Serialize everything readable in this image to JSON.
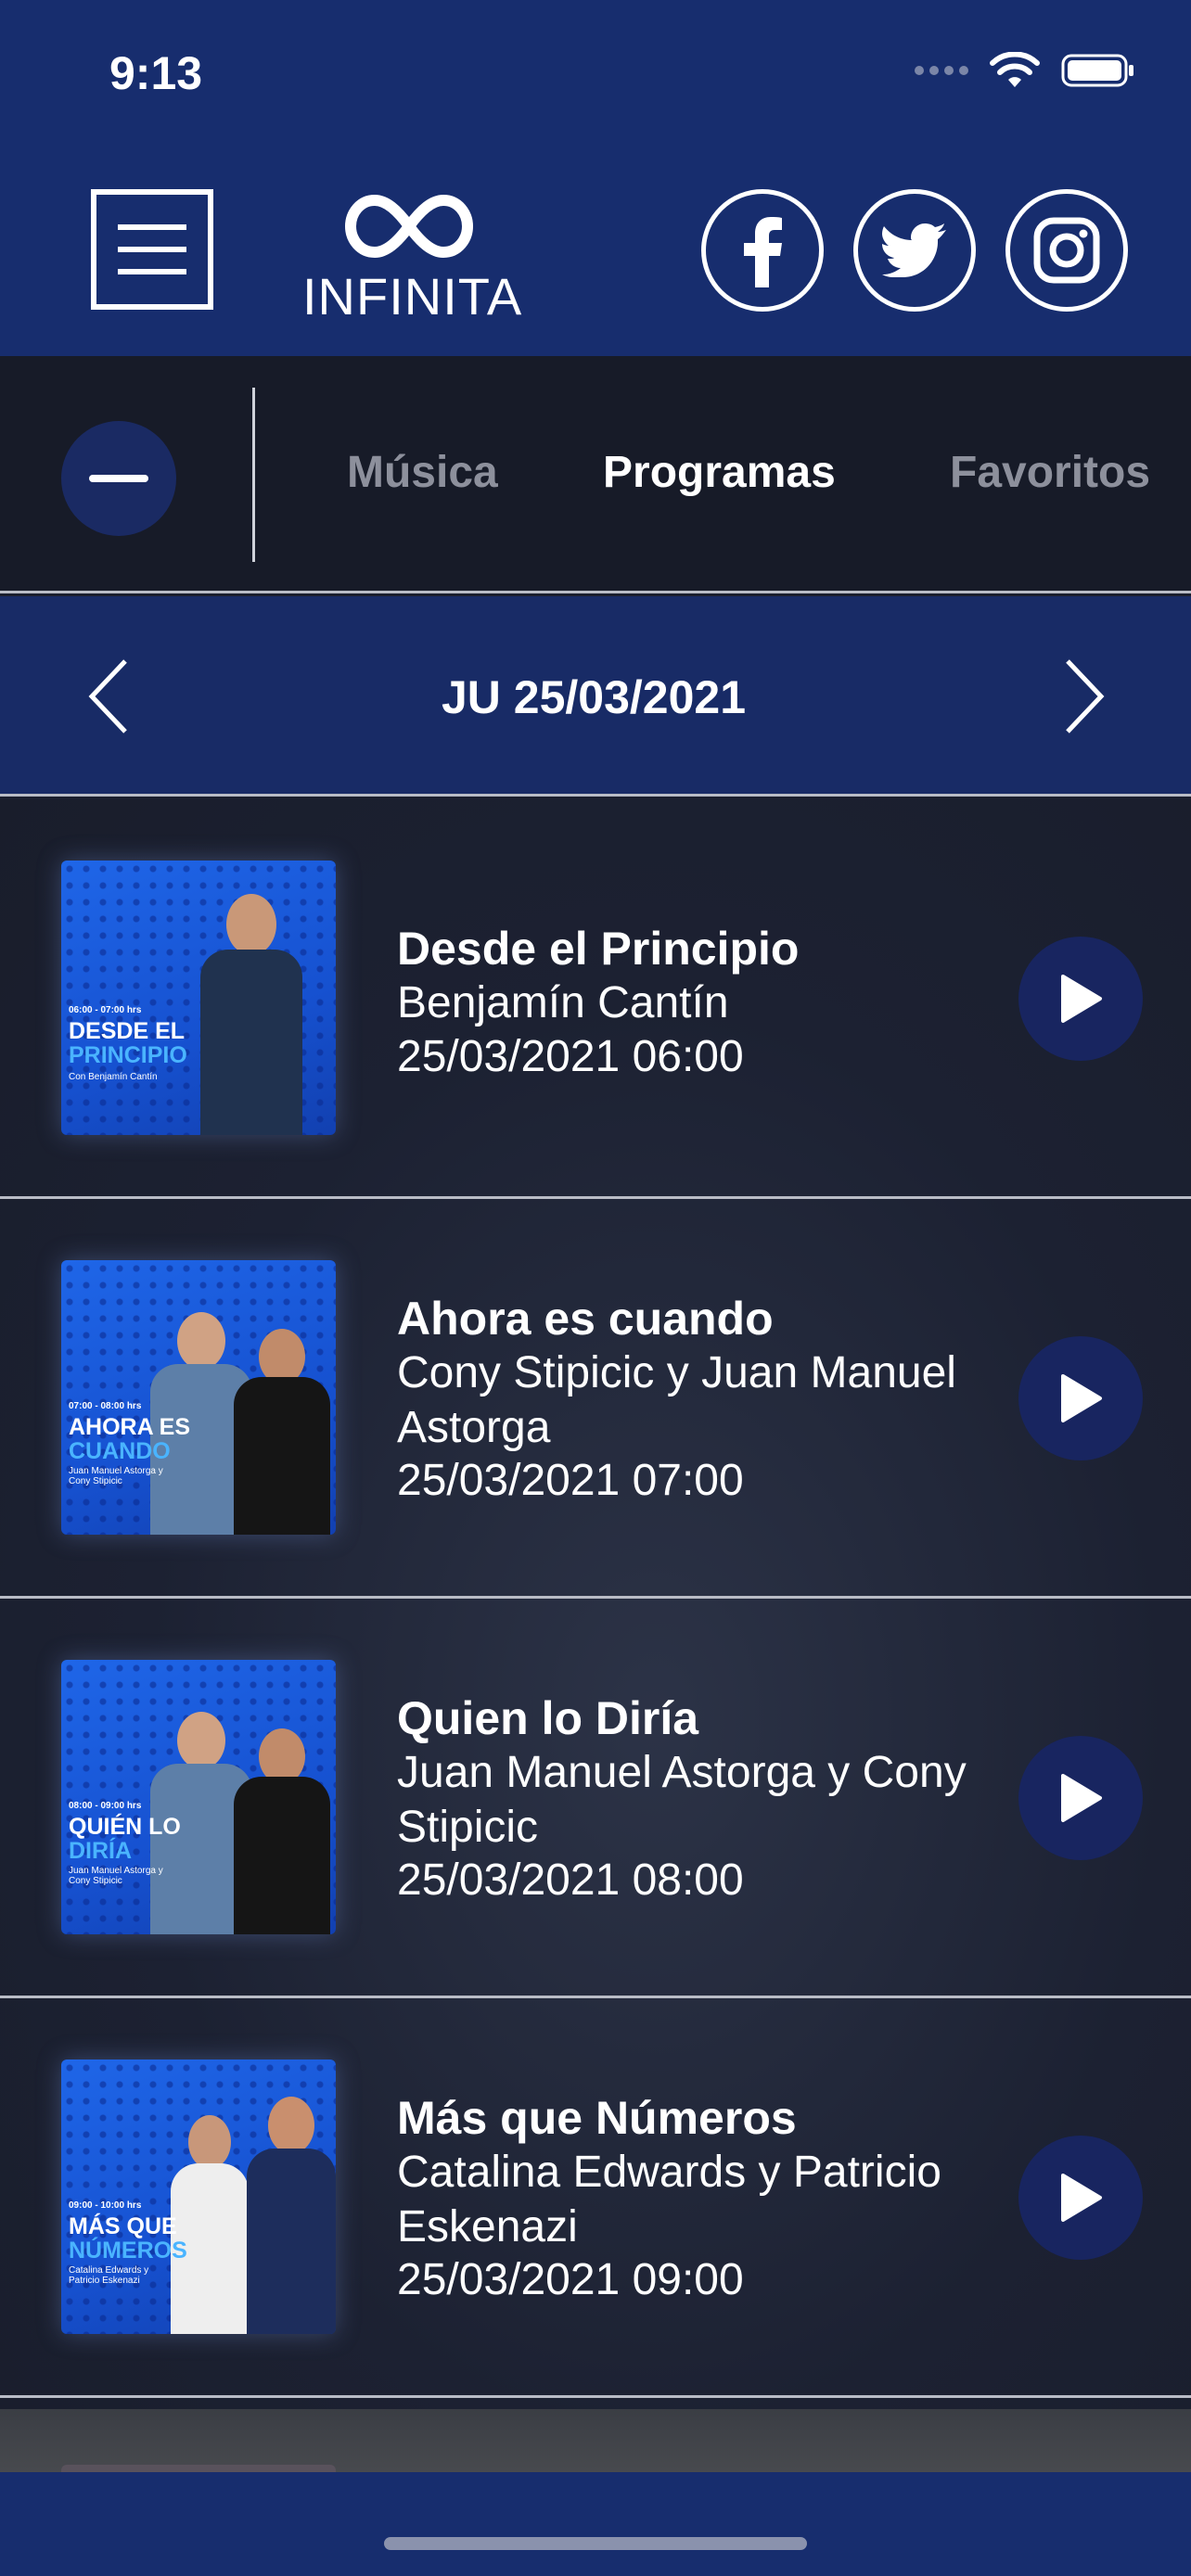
{
  "status_bar": {
    "time": "9:13"
  },
  "header": {
    "logo_text": "INFINITA",
    "social": [
      "facebook",
      "twitter",
      "instagram"
    ]
  },
  "tabs": [
    {
      "label": "Música",
      "active": false
    },
    {
      "label": "Programas",
      "active": true
    },
    {
      "label": "Favoritos",
      "active": false
    }
  ],
  "date_nav": {
    "label": "JU 25/03/2021"
  },
  "programs": [
    {
      "title": "Desde el Principio",
      "hosts": "Benjamín Cantín",
      "datetime": "25/03/2021 06:00",
      "thumb": {
        "time": "06:00 - 07:00 hrs",
        "line1": "DESDE EL",
        "line2": "PRINCIPIO",
        "host": "Con Benjamín Cantín"
      }
    },
    {
      "title": "Ahora es cuando",
      "hosts": "Cony Stipicic y Juan Manuel Astorga",
      "datetime": "25/03/2021 07:00",
      "thumb": {
        "time": "07:00 - 08:00 hrs",
        "line1": "AHORA ES",
        "line2": "CUANDO",
        "host": "Juan Manuel Astorga y Cony Stipicic"
      }
    },
    {
      "title": "Quien lo Diría",
      "hosts": "Juan Manuel Astorga y Cony Stipicic",
      "datetime": "25/03/2021 08:00",
      "thumb": {
        "time": "08:00 - 09:00 hrs",
        "line1": "QUIÉN LO",
        "line2": "DIRÍA",
        "host": "Juan Manuel Astorga y Cony Stipicic"
      }
    },
    {
      "title": "Más que Números",
      "hosts": "Catalina Edwards y Patricio Eskenazi",
      "datetime": "25/03/2021 09:00",
      "thumb": {
        "time": "09:00 - 10:00 hrs",
        "line1": "MÁS QUE",
        "line2": "NÚMEROS",
        "host": "Catalina Edwards y Patricio Eskenazi"
      }
    }
  ],
  "colors": {
    "header_bg": "#172d6e",
    "list_bg": "#1c2132",
    "accent_blue": "#1f66e8",
    "play_bg": "#182560"
  },
  "icons": {
    "menu": "hamburger-menu-icon",
    "collapse": "minus-icon",
    "prev": "chevron-left-icon",
    "next": "chevron-right-icon",
    "play": "play-icon"
  }
}
